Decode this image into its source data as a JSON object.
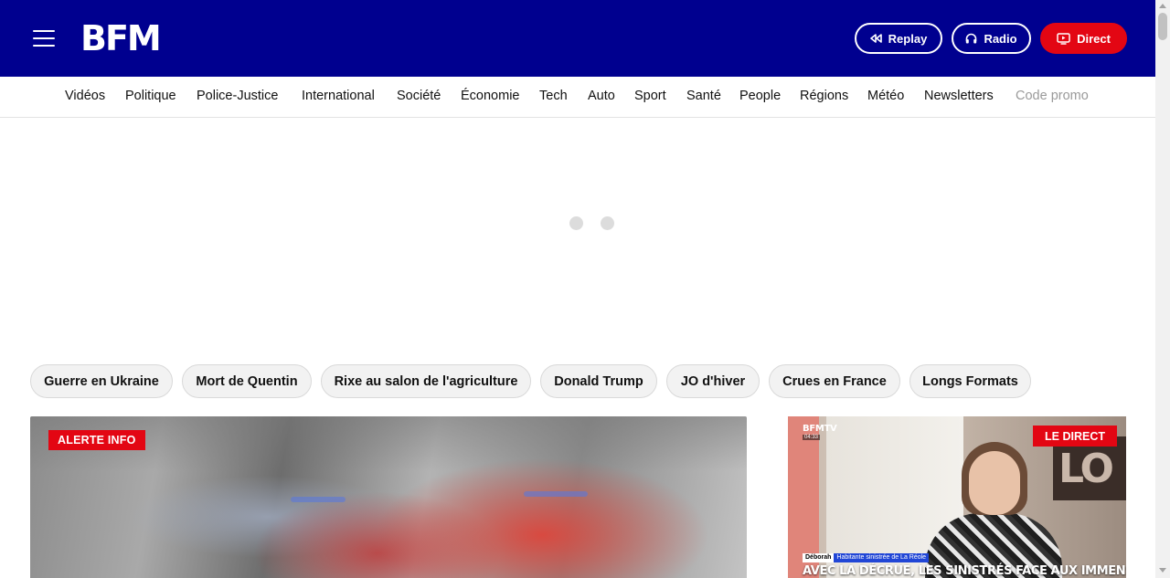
{
  "header": {
    "logo": "BFM",
    "buttons": {
      "replay": "Replay",
      "radio": "Radio",
      "direct": "Direct"
    },
    "colors": {
      "background": "#00008f",
      "accent": "#e30613"
    },
    "icons": [
      "menu-icon",
      "replay-icon",
      "headphones-icon",
      "tv-play-icon"
    ]
  },
  "nav": {
    "items": [
      "Vidéos",
      "Politique",
      "Police-Justice",
      "International",
      "Société",
      "Économie",
      "Tech",
      "Auto",
      "Sport",
      "Santé",
      "People",
      "Régions",
      "Météo",
      "Newsletters",
      "Code promo"
    ]
  },
  "tags": [
    "Guerre en Ukraine",
    "Mort de Quentin",
    "Rixe au salon de l'agriculture",
    "Donald Trump",
    "JO d'hiver",
    "Crues en France",
    "Longs Formats"
  ],
  "main_article": {
    "badge": "ALERTE INFO"
  },
  "live": {
    "badge": "LE DIRECT",
    "channel": "BFMTV",
    "time": "04:33",
    "person_name": "Déborah",
    "person_role": "Habitante sinistrée de La Réole",
    "headline": "AVEC LA DÉCRUE, LES SINISTRÉS FACE AUX IMMENSES DÉGÂTS"
  }
}
